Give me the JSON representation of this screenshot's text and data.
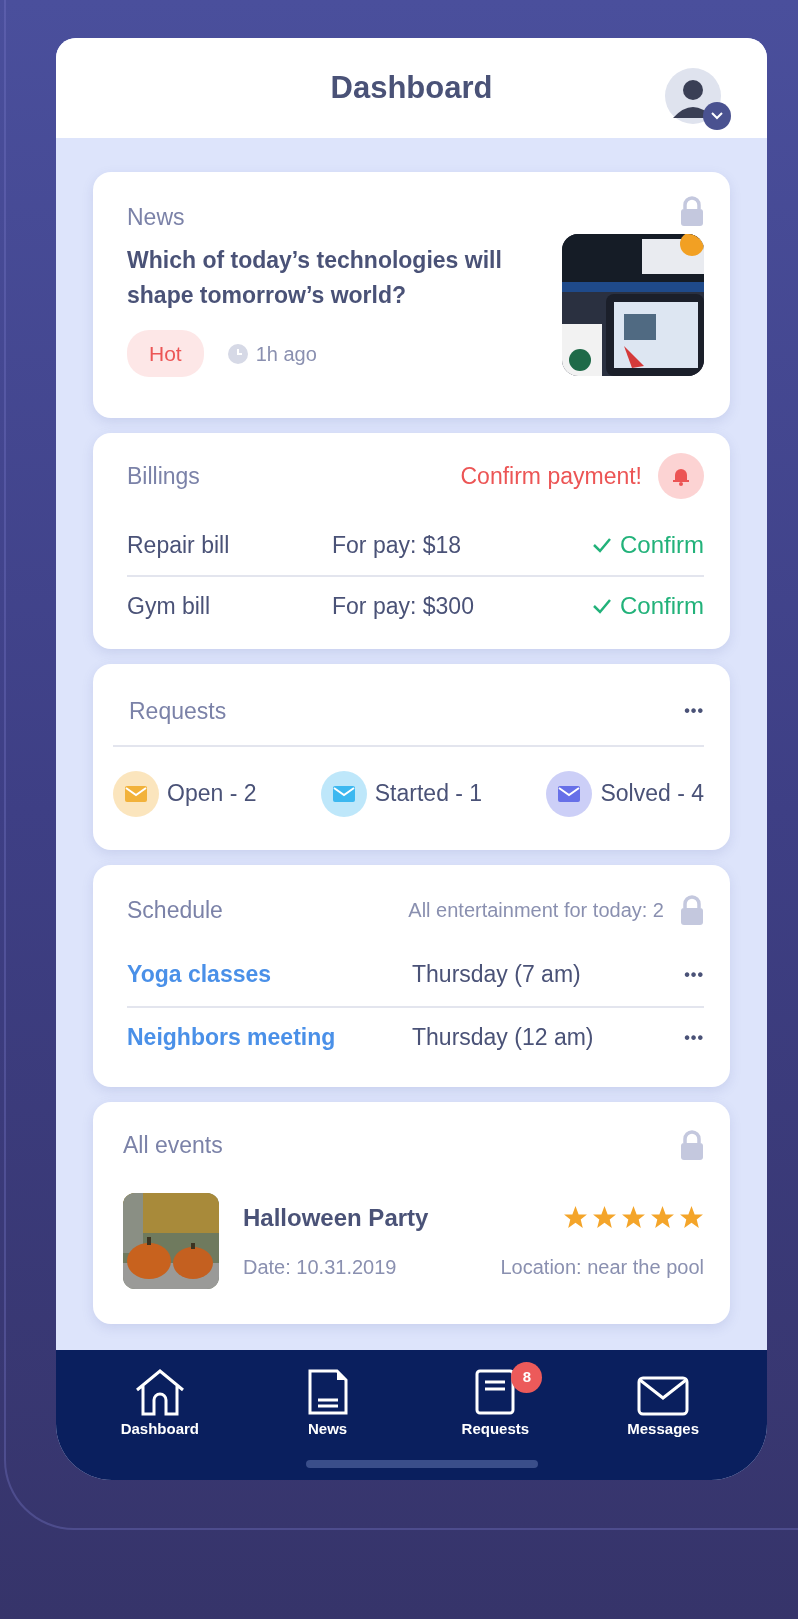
{
  "header": {
    "title": "Dashboard"
  },
  "news": {
    "title": "News",
    "headline": "Which of today’s technologies will shape tomorrow’s world?",
    "tag": "Hot",
    "time": "1h ago"
  },
  "billings": {
    "title": "Billings",
    "alert": "Confirm payment!",
    "bills": [
      {
        "name": "Repair bill",
        "amount": "For pay: $18",
        "action": "Confirm"
      },
      {
        "name": "Gym bill",
        "amount": "For pay: $300",
        "action": "Confirm"
      }
    ]
  },
  "requests": {
    "title": "Requests",
    "more": "•••",
    "statuses": [
      {
        "label": "Open - 2",
        "color": "#f2b23a"
      },
      {
        "label": "Started - 1",
        "color": "#3cb8f0"
      },
      {
        "label": "Solved - 4",
        "color": "#6770e8"
      }
    ]
  },
  "schedule": {
    "title": "Schedule",
    "summary": "All entertainment for today: 2",
    "items": [
      {
        "name": "Yoga classes",
        "time": "Thursday (7 am)",
        "more": "•••"
      },
      {
        "name": "Neighbors meeting",
        "time": "Thursday (12 am)",
        "more": "•••"
      }
    ]
  },
  "events": {
    "title": "All events",
    "items": [
      {
        "name": "Halloween Party",
        "stars": 5,
        "date": "Date: 10.31.2019",
        "location": "Location: near the pool"
      }
    ]
  },
  "tab_bar": {
    "tabs": [
      {
        "kind": "home",
        "label": "Dashboard"
      },
      {
        "kind": "doc",
        "label": "News"
      },
      {
        "kind": "list",
        "label": "Requests",
        "badge": "8"
      },
      {
        "kind": "mail",
        "label": "Messages"
      }
    ]
  }
}
